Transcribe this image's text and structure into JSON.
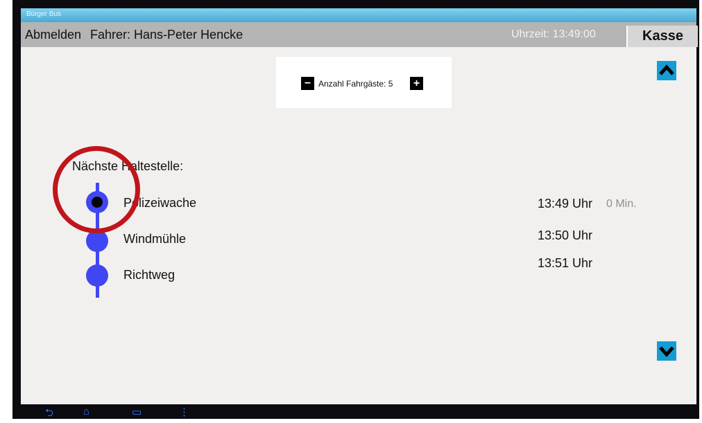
{
  "window": {
    "title": "Bürger Bus"
  },
  "header": {
    "logout_label": "Abmelden",
    "driver_label": "Fahrer: Hans-Peter Hencke",
    "time_label": "Uhrzeit: 13:49:00",
    "cashbox_label": "Kasse"
  },
  "passengers": {
    "label": "Anzahl Fahrgäste: 5",
    "decrement_icon": "minus-icon",
    "increment_icon": "plus-icon"
  },
  "stops_section": {
    "heading": "Nächste Haltestelle:"
  },
  "stops": [
    {
      "name": "Polizeiwache",
      "time": "13:49 Uhr",
      "delay": "0 Min."
    },
    {
      "name": "Windmühle",
      "time": "13:50 Uhr"
    },
    {
      "name": "Richtweg",
      "time": "13:51 Uhr"
    }
  ],
  "colors": {
    "accent_blue": "#4046f2",
    "scroll_button": "#159dd3",
    "highlight_red": "#c0151b"
  },
  "navigation": [
    "back-icon",
    "home-icon",
    "recent-apps-icon",
    "menu-icon"
  ]
}
